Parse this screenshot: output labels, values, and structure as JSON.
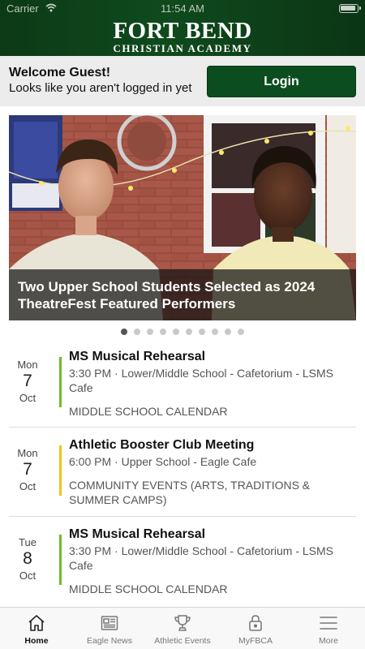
{
  "status_bar": {
    "carrier": "Carrier",
    "time": "11:54 AM"
  },
  "header": {
    "logo_line1": "FORT BEND",
    "logo_line2": "CHRISTIAN ACADEMY",
    "background_color": "#0f4a1d"
  },
  "welcome": {
    "title": "Welcome Guest!",
    "subtitle": "Looks like you aren't logged in yet",
    "login_label": "Login",
    "login_color": "#0b4d1f"
  },
  "hero": {
    "caption": "Two Upper School Students Selected as 2024 TheatreFest Featured Performers",
    "slide_count": 10,
    "active_slide": 1
  },
  "events": [
    {
      "dow": "Mon",
      "day": "7",
      "month": "Oct",
      "title": "MS Musical Rehearsal",
      "meta": "3:30 PM · Lower/Middle School - Cafetorium - LSMS Cafe",
      "calendar": "MIDDLE SCHOOL CALENDAR",
      "accent_color": "#6cbf2a"
    },
    {
      "dow": "Mon",
      "day": "7",
      "month": "Oct",
      "title": "Athletic Booster Club Meeting",
      "meta": "6:00 PM · Upper School - Eagle Cafe",
      "calendar": "COMMUNITY EVENTS (ARTS, TRADITIONS & SUMMER CAMPS)",
      "accent_color": "#f2c21b"
    },
    {
      "dow": "Tue",
      "day": "8",
      "month": "Oct",
      "title": "MS Musical Rehearsal",
      "meta": "3:30 PM · Lower/Middle School - Cafetorium - LSMS Cafe",
      "calendar": "MIDDLE SCHOOL CALENDAR",
      "accent_color": "#6cbf2a"
    }
  ],
  "tabbar": {
    "tabs": [
      {
        "label": "Home",
        "icon": "home-icon",
        "active": true
      },
      {
        "label": "Eagle News",
        "icon": "newspaper-icon",
        "active": false
      },
      {
        "label": "Athletic Events",
        "icon": "trophy-icon",
        "active": false
      },
      {
        "label": "MyFBCA",
        "icon": "lock-icon",
        "active": false
      },
      {
        "label": "More",
        "icon": "menu-icon",
        "active": false
      }
    ]
  }
}
